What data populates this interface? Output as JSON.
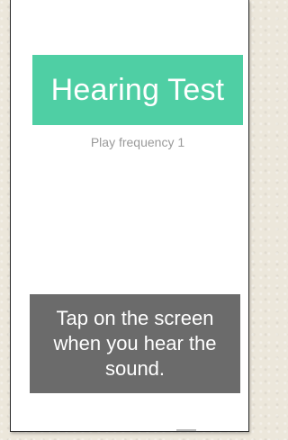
{
  "header": {
    "title": "Hearing Test"
  },
  "status": {
    "text": "Play frequency 1"
  },
  "instruction": {
    "text": "Tap on the screen when you hear the sound."
  },
  "colors": {
    "accent": "#4fcfa4",
    "panel": "#6b6b6b",
    "status_text": "#9a9a9a",
    "screen_background": "#ffffff"
  }
}
